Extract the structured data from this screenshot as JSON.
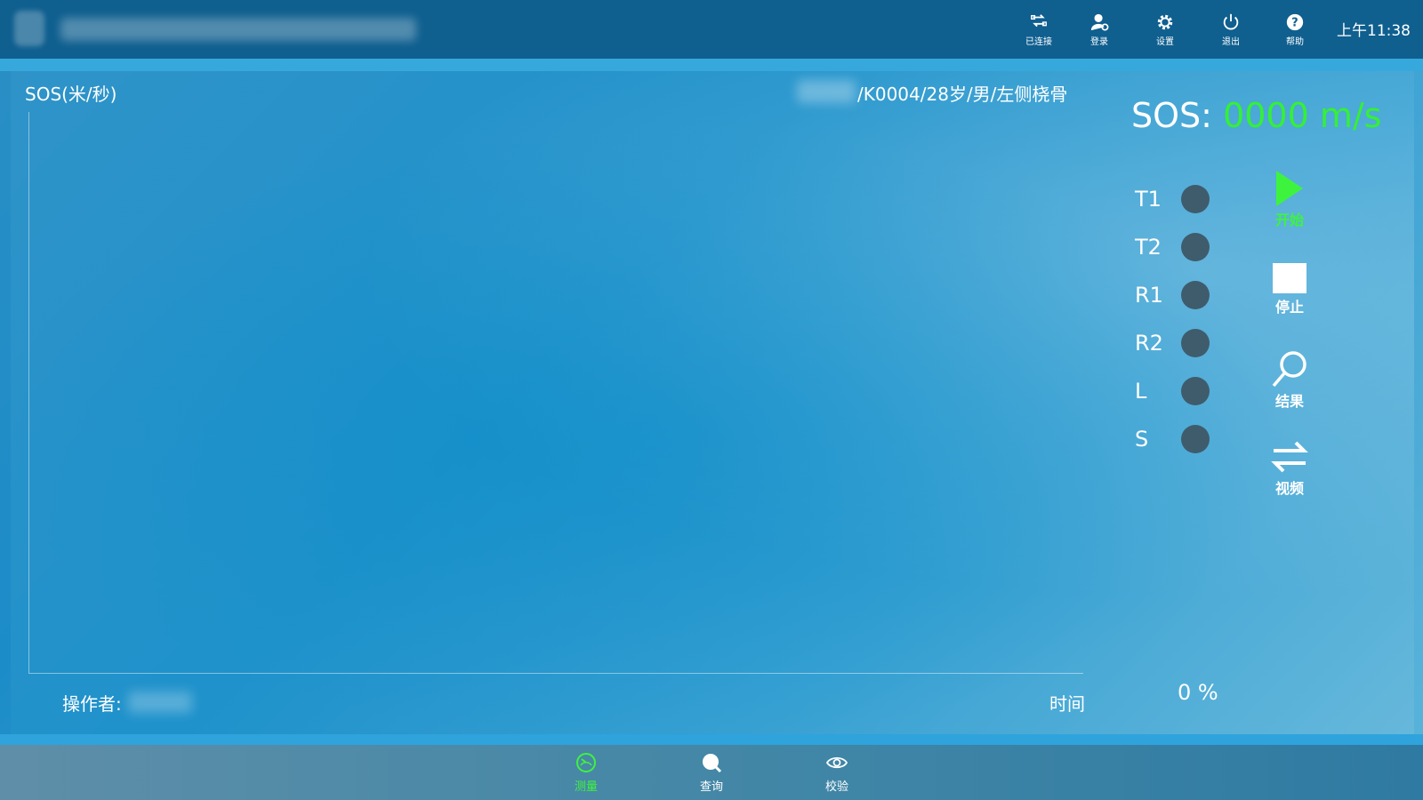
{
  "topbar": {
    "buttons": [
      {
        "label": "已连接",
        "icon": "connect-icon"
      },
      {
        "label": "登录",
        "icon": "user-icon"
      },
      {
        "label": "设置",
        "icon": "gear-icon"
      },
      {
        "label": "退出",
        "icon": "power-icon"
      },
      {
        "label": "帮助",
        "icon": "help-icon"
      }
    ],
    "clock": "上午11:38"
  },
  "main": {
    "y_axis_label": "SOS(米/秒)",
    "patient_info": "/K0004/28岁/男/左侧桡骨",
    "sos_prefix": "SOS:",
    "sos_value": "0000 m/s",
    "operator_label": "操作者:",
    "time_label": "时间",
    "progress": "0 %"
  },
  "indicators": [
    {
      "label": "T1"
    },
    {
      "label": "T2"
    },
    {
      "label": "R1"
    },
    {
      "label": "R2"
    },
    {
      "label": "L"
    },
    {
      "label": "S"
    }
  ],
  "actions": {
    "start": "开始",
    "stop": "停止",
    "result": "结果",
    "video": "视频"
  },
  "bottomnav": [
    {
      "label": "测量",
      "icon": "gauge-icon",
      "active": true
    },
    {
      "label": "查询",
      "icon": "search-icon",
      "active": false
    },
    {
      "label": "校验",
      "icon": "eye-icon",
      "active": false
    }
  ],
  "colors": {
    "accent_green": "#35f035",
    "topbar": "#0f5f8f",
    "indicator_off": "#3f5c6c"
  }
}
